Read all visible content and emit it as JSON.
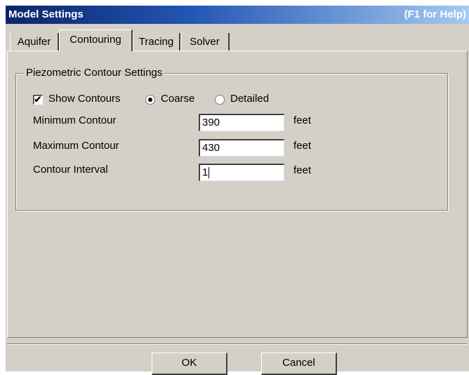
{
  "window": {
    "title": "Model Settings",
    "help": "(F1 for Help)"
  },
  "tabs": [
    {
      "label": "Aquifer"
    },
    {
      "label": "Contouring",
      "active": true
    },
    {
      "label": "Tracing"
    },
    {
      "label": "Solver"
    }
  ],
  "group": {
    "label": "Piezometric Contour Settings",
    "show_contours": {
      "label": "Show Contours",
      "checked": true,
      "mark": "✔"
    },
    "resolution": {
      "options": [
        {
          "label": "Coarse",
          "selected": true
        },
        {
          "label": "Detailed",
          "selected": false
        }
      ]
    },
    "fields": [
      {
        "label": "Minimum Contour",
        "value": "390",
        "unit": "feet"
      },
      {
        "label": "Maximum Contour",
        "value": "430",
        "unit": "feet"
      },
      {
        "label": "Contour Interval",
        "value": "1",
        "unit": "feet"
      }
    ]
  },
  "buttons": {
    "ok": "OK",
    "cancel": "Cancel"
  }
}
